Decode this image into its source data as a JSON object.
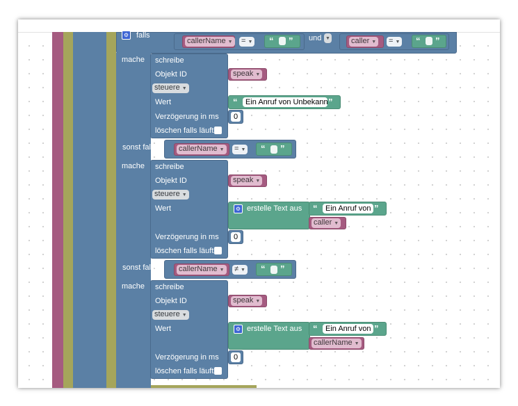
{
  "if_block": {
    "falls": "falls",
    "left": {
      "var": "callerName",
      "op": "=",
      "quote_open": "“",
      "quote_close": "”"
    },
    "und": "und",
    "right": {
      "var": "caller",
      "op": "=",
      "quote_open": "“",
      "quote_close": "”"
    }
  },
  "branch1": {
    "mache": "mache",
    "schreibe": "schreibe",
    "objekt_id": "Objekt ID",
    "object": "speak",
    "mode": "steuere",
    "wert": "Wert",
    "value_text": "Ein Anruf von Unbekannt",
    "quote_open": "“",
    "quote_close": "”",
    "delay_label": "Verzögerung in ms",
    "delay": "0",
    "clear_label": "löschen falls läuft"
  },
  "elseif1": {
    "label": "sonst falls",
    "var": "callerName",
    "op": "=",
    "quote_open": "“",
    "quote_close": "”"
  },
  "branch2": {
    "mache": "mache",
    "schreibe": "schreibe",
    "objekt_id": "Objekt ID",
    "object": "speak",
    "mode": "steuere",
    "wert": "Wert",
    "create_text": "erstelle Text aus",
    "text_item": "Ein Anruf von",
    "quote_open": "“",
    "quote_close": "”",
    "var_item": "caller",
    "delay_label": "Verzögerung in ms",
    "delay": "0",
    "clear_label": "löschen falls läuft"
  },
  "elseif2": {
    "label": "sonst falls",
    "var": "callerName",
    "op": "≠",
    "quote_open": "“",
    "quote_close": "”"
  },
  "branch3": {
    "mache": "mache",
    "schreibe": "schreibe",
    "objekt_id": "Objekt ID",
    "object": "speak",
    "mode": "steuere",
    "wert": "Wert",
    "create_text": "erstelle Text aus",
    "text_item": "Ein Anruf von",
    "quote_open": "“",
    "quote_close": "”",
    "var_item": "callerName",
    "delay_label": "Verzögerung in ms",
    "delay": "0",
    "clear_label": "löschen falls läuft"
  },
  "colors": {
    "logic": "#5b80a5",
    "text": "#5ba58c",
    "variable": "#a55b80",
    "loop": "#a5a55b"
  },
  "icons": {
    "gear": "gear-icon",
    "dropdown": "dropdown-arrow-icon"
  }
}
